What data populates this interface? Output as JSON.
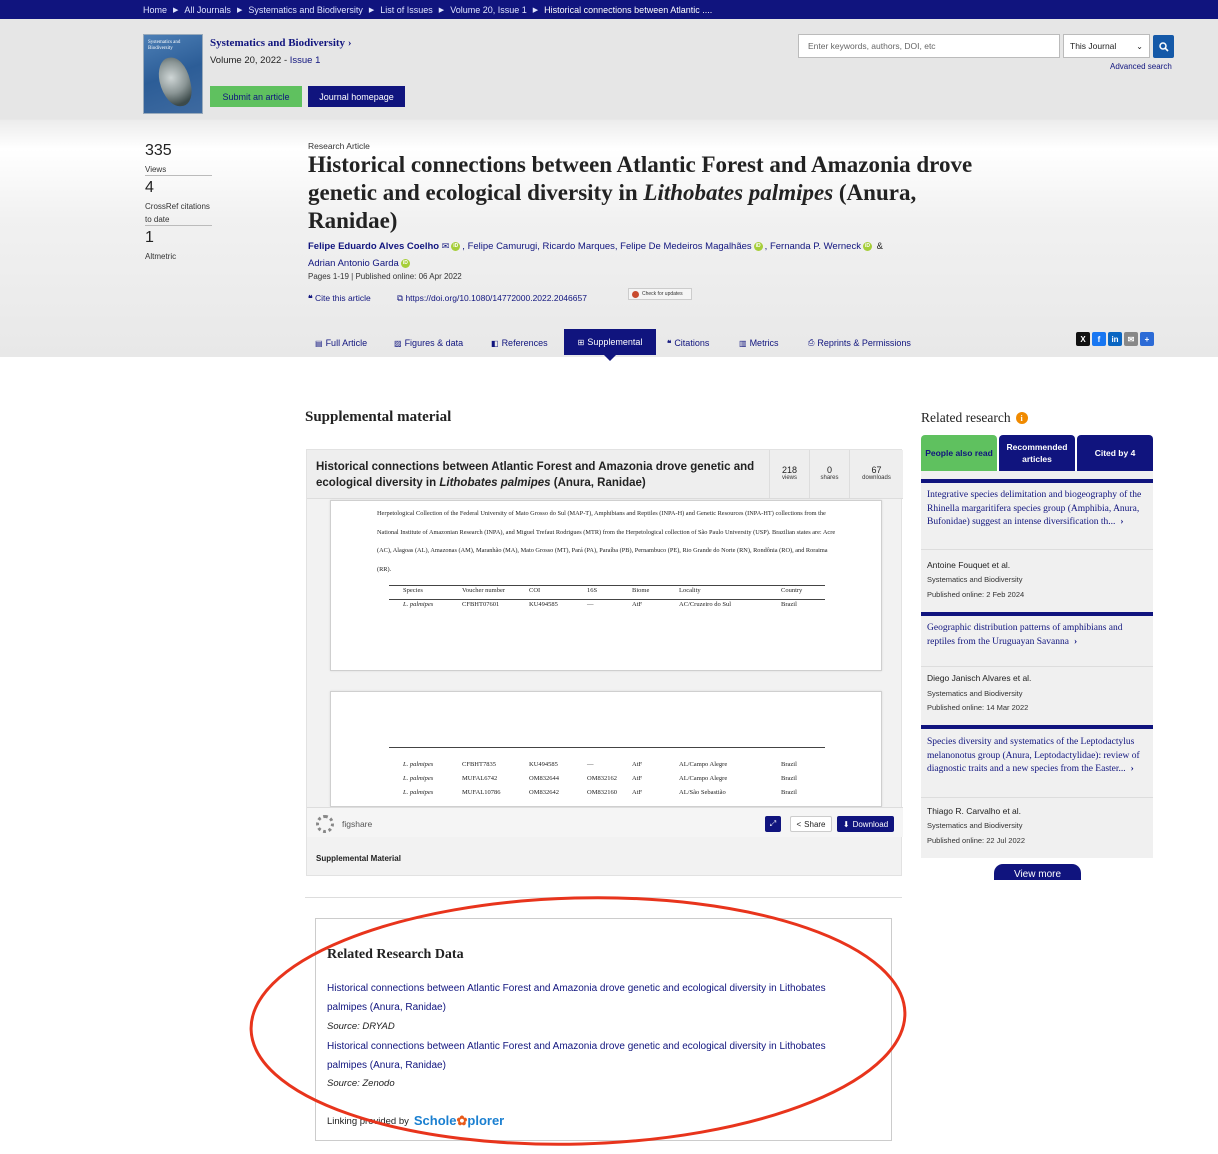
{
  "breadcrumb": [
    "Home",
    "All Journals",
    "Systematics and Biodiversity",
    "List of Issues",
    "Volume 20, Issue 1",
    "Historical connections between Atlantic ...."
  ],
  "journal": {
    "cover_title": "Systematics and Biodiversity",
    "title": "Systematics and Biodiversity",
    "volume": "Volume 20, 2022 - ",
    "issue": "Issue 1",
    "submit_label": "Submit an article",
    "homepage_label": "Journal homepage"
  },
  "search": {
    "placeholder": "Enter keywords, authors, DOI, etc",
    "scope": "This Journal",
    "advanced": "Advanced search"
  },
  "metrics": [
    {
      "value": "335",
      "label": "Views"
    },
    {
      "value": "4",
      "label": "CrossRef citations to date"
    },
    {
      "value": "1",
      "label": "Altmetric"
    }
  ],
  "article": {
    "type": "Research Article",
    "title_part1": "Historical connections between Atlantic Forest and Amazonia drove genetic and ecological diversity in ",
    "title_italic": "Lithobates palmipes",
    "title_part2": " (Anura, Ranidae)",
    "authors": [
      "Felipe Eduardo Alves Coelho",
      "Felipe Camurugi",
      "Ricardo Marques",
      "Felipe De Medeiros Magalhães",
      "Fernanda P. Werneck",
      "Adrian Antonio Garda"
    ],
    "pages": "Pages 1-19 | Published online: 06 Apr 2022",
    "cite_label": "Cite this article",
    "doi": "https://doi.org/10.1080/14772000.2022.2046657",
    "check_label": "Check for updates"
  },
  "tabs": [
    {
      "label": "Full Article",
      "icon": "document-icon"
    },
    {
      "label": "Figures & data",
      "icon": "image-icon"
    },
    {
      "label": "References",
      "icon": "book-icon"
    },
    {
      "label": "Supplemental",
      "icon": "plus-square-icon"
    },
    {
      "label": "Citations",
      "icon": "quote-icon"
    },
    {
      "label": "Metrics",
      "icon": "bar-chart-icon"
    },
    {
      "label": "Reprints & Permissions",
      "icon": "printer-icon"
    }
  ],
  "share": [
    "x-icon",
    "facebook-icon",
    "linkedin-icon",
    "email-icon",
    "share-icon"
  ],
  "supplemental": {
    "heading": "Supplemental material",
    "file_title_part1": "Historical connections between Atlantic Forest and Amazonia drove genetic and ecological diversity in ",
    "file_title_italic": "Lithobates palmipes",
    "file_title_part2": " (Anura, Ranidae)",
    "stats": [
      {
        "value": "218",
        "label": "views"
      },
      {
        "value": "0",
        "label": "shares"
      },
      {
        "value": "67",
        "label": "downloads"
      }
    ],
    "doc_text": "Herpetological Collection of the Federal University of Mato Grosso do Sul (MAP-T), Amphibians and Reptiles (INPA-H) and Genetic Resources (INPA-HT) collections from the National Institute of Amazonian Research (INPA), and Miguel Trefaut Rodrigues (MTR) from the Herpetological collection of São Paulo University (USP). Brazilian states are: Acre (AC), Alagoas (AL), Amazonas (AM), Maranhão (MA), Mato Grosso (MT), Pará (PA), Paraíba (PB), Pernambuco (PE), Rio Grande do Norte (RN), Rondônia (RO), and Roraima (RR).",
    "table_headers": [
      "Species",
      "Voucher number",
      "COI",
      "16S",
      "Biome",
      "Locality",
      "Country"
    ],
    "table_row1": [
      "L. palmipes",
      "CFBHT07601",
      "KU494585",
      "—",
      "AtF",
      "AC/Cruzeiro do Sul",
      "Brazil"
    ],
    "table_rows2": [
      [
        "L. palmipes",
        "CFBHT7835",
        "KU494585",
        "—",
        "AtF",
        "AL/Campo Alegre",
        "Brazil"
      ],
      [
        "L. palmipes",
        "MUFAL6742",
        "OM832644",
        "OM832162",
        "AtF",
        "AL/Campo Alegre",
        "Brazil"
      ],
      [
        "L. palmipes",
        "MUFAL10786",
        "OM832642",
        "OM832160",
        "AtF",
        "AL/São Sebastião",
        "Brazil"
      ]
    ],
    "figshare": "figshare",
    "share_label": "Share",
    "download_label": "Download",
    "file_label": "Supplemental Material"
  },
  "related_data": {
    "heading": "Related Research Data",
    "items": [
      {
        "title": "Historical connections between Atlantic Forest and Amazonia drove genetic and ecological diversity in Lithobates palmipes (Anura, Ranidae)",
        "source": "Source: DRYAD"
      },
      {
        "title": "Historical connections between Atlantic Forest and Amazonia drove genetic and ecological diversity in Lithobates palmipes (Anura, Ranidae)",
        "source": "Source: Zenodo"
      }
    ],
    "provided_by": "Linking provided by",
    "provider_a": "Schole",
    "provider_b": "plorer"
  },
  "related_research": {
    "heading": "Related research",
    "tabs": [
      "People also read",
      "Recommended articles",
      "Cited by 4"
    ],
    "items": [
      {
        "title": "Integrative species delimitation and biogeography of the Rhinella margaritifera species group (Amphibia, Anura, Bufonidae) suggest an intense diversification th...",
        "author": "Antoine Fouquet et al.",
        "journal": "Systematics and Biodiversity",
        "date": "Published online: 2 Feb 2024"
      },
      {
        "title": "Geographic distribution patterns of amphibians and reptiles from the Uruguayan Savanna",
        "author": "Diego Janisch Alvares et al.",
        "journal": "Systematics and Biodiversity",
        "date": "Published online: 14 Mar 2022"
      },
      {
        "title": "Species diversity and systematics of the Leptodactylus melanonotus group (Anura, Leptodactylidae): review of diagnostic traits and a new species from the Easter...",
        "author": "Thiago R. Carvalho et al.",
        "journal": "Systematics and Biodiversity",
        "date": "Published online: 22 Jul 2022"
      }
    ],
    "view_more": "View more"
  },
  "colors": {
    "brand_navy": "#10147e",
    "green": "#5fc15f",
    "annotation_red": "#e8341c"
  }
}
